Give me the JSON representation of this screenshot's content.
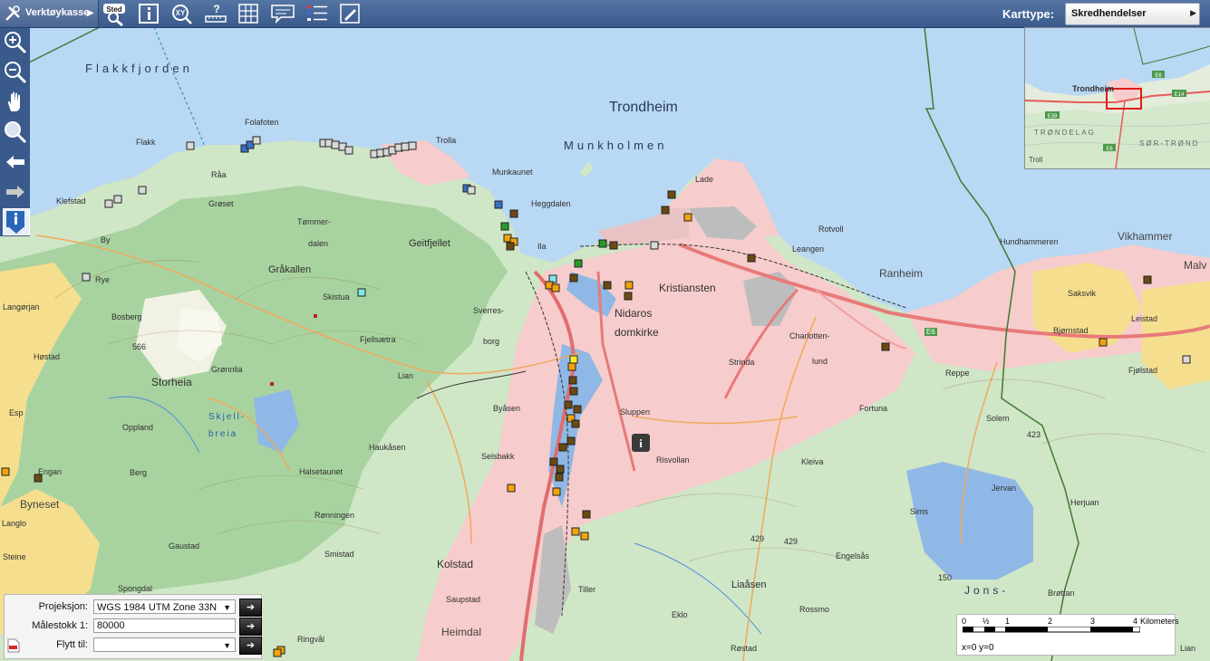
{
  "toolbar": {
    "verktoykasse_label": "Verktøykasse",
    "sted_label": "Sted",
    "xy_label": "XY",
    "karttype_label": "Karttype:",
    "karttype_value": "Skredhendelser"
  },
  "sidebar": {
    "buttons": [
      "zoom-in",
      "zoom-out",
      "pan",
      "zoom-box",
      "back",
      "forward",
      "info"
    ]
  },
  "panel": {
    "projeksjon_label": "Projeksjon:",
    "projeksjon_value": "WGS 1984 UTM Zone 33N",
    "malestokk_label": "Målestokk 1:",
    "malestokk_value": "80000",
    "flytt_label": "Flytt til:",
    "flytt_value": ""
  },
  "scalebar": {
    "ticks": [
      "0",
      "½",
      "1",
      "2",
      "3",
      "4"
    ],
    "unit": "Kilometers",
    "coords": "x=0 y=0"
  },
  "overview": {
    "labels": {
      "city": "Trondheim",
      "region1": "TRØNDELAG",
      "region2": "SØR-TRØND",
      "troll": "Troll",
      "r1": "E6",
      "r2": "E14",
      "r3": "E39",
      "r4": "E6"
    }
  },
  "map_labels": {
    "flakkfjorden": "Flakkfjorden",
    "trondheim": "Trondheim",
    "munkholmen": "Munkholmen",
    "folafoten": "Folafoten",
    "flakk": "Flakk",
    "trolla": "Trolla",
    "munkaunet": "Munkaunet",
    "heggdalen": "Heggdalen",
    "lade": "Lade",
    "raa": "Råa",
    "groset": "Grøset",
    "klefstad": "Klefstad",
    "tommerdalen1": "Tømmer-",
    "tommerdalen2": "dalen",
    "geitfjellet": "Geitfjellet",
    "ila": "Ila",
    "rotvoll": "Rotvoll",
    "leangen": "Leangen",
    "ranheim": "Ranheim",
    "hundhammeren": "Hundhammeren",
    "vikhammer": "Vikhammer",
    "malvik": "Malv",
    "by": "By",
    "rye": "Rye",
    "grakallen": "Gråkallen",
    "skistua": "Skistua",
    "sverresborg1": "Sverres-",
    "sverresborg2": "borg",
    "kristiansten": "Kristiansten",
    "nidaros1": "Nidaros",
    "nidaros2": "domkirke",
    "saksvik": "Saksvik",
    "langorjan": "Langørjan",
    "bosberg": "Bosberg",
    "h566": "566",
    "fjellsaetra": "Fjellsætra",
    "charlottenlund1": "Charlotten-",
    "charlottenlund2": "lund",
    "strinda": "Strinda",
    "bjornstad": "Bjørnstad",
    "leistad": "Leistad",
    "e6": "E6",
    "hostad": "Høstad",
    "storheia": "Storheia",
    "gronnlia": "Grønnlia",
    "lian": "Lian",
    "reppe": "Reppe",
    "fjolstad": "Fjølstad",
    "esp": "Esp",
    "skjellbreia1": "Skjell-",
    "skjellbreia2": "breia",
    "byasen": "Byåsen",
    "sluppen": "Sluppen",
    "fortuna": "Fortuna",
    "solem": "Solem",
    "oppland": "Oppland",
    "h423": "423",
    "haukasen": "Haukåsen",
    "engan": "Engan",
    "byneset": "Byneset",
    "selsbakk": "Selsbakk",
    "risvollan": "Risvollan",
    "kleiva": "Kleiva",
    "berg": "Berg",
    "halsetaunet": "Halsetaunet",
    "jervan": "Jervan",
    "herjuan": "Herjuan",
    "langlo": "Langlo",
    "ronningen": "Rønningen",
    "sims": "Sims",
    "steine": "Steine",
    "gaustad": "Gaustad",
    "smistad": "Smistad",
    "h429a": "429",
    "h429b": "429",
    "engelsas": "Engelsås",
    "h150": "150",
    "kolstad": "Kolstad",
    "spongdal": "Spongdal",
    "jons": "Jons-",
    "tiller": "Tiller",
    "liaasen": "Liaåsen",
    "saupstad": "Saupstad",
    "brottan": "Brøttan",
    "rossmo": "Rossmo",
    "eklo": "Eklo",
    "heimdal": "Heimdal",
    "ringval": "Ringvål",
    "rostad": "Røstad",
    "lian2": "Lian"
  },
  "markers_legend": {
    "colors": {
      "dark_brown": "#6b4a12",
      "orange": "#f2a20c",
      "gray": "#d9d9d9",
      "blue": "#3a6fc4",
      "green": "#2a9a2a",
      "cyan": "#7fe7e7",
      "yellow": "#ffee22"
    }
  }
}
